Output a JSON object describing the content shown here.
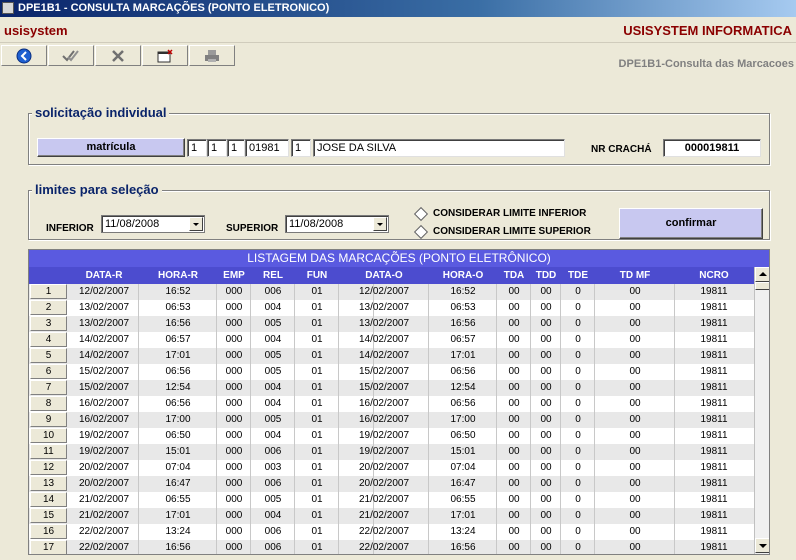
{
  "window": {
    "title": "DPE1B1 - CONSULTA MARCAÇÕES (PONTO ELETRONICO)"
  },
  "brand": {
    "left": "usisystem",
    "right": "USISYSTEM INFORMATICA"
  },
  "toolbar": {
    "buttons": [
      {
        "icon": "back-arrow-icon"
      },
      {
        "icon": "double-check-icon"
      },
      {
        "icon": "x-cancel-icon"
      },
      {
        "icon": "new-window-icon"
      },
      {
        "icon": "printer-icon"
      }
    ]
  },
  "subtitle": "DPE1B1-Consulta das Marcacoes",
  "individual": {
    "title": "solicitação individual",
    "matricula_button": "matrícula",
    "matricula_parts": [
      "1",
      "1",
      "1",
      "01981",
      "1"
    ],
    "name": "JOSE DA SILVA",
    "cracha_label": "NR CRACHÁ",
    "cracha_value": "000019811"
  },
  "limits": {
    "title": "limites para seleção",
    "inferior_label": "INFERIOR",
    "inferior_value": "11/08/2008",
    "superior_label": "SUPERIOR",
    "superior_value": "11/08/2008",
    "check_inferior": "CONSIDERAR LIMITE INFERIOR",
    "check_superior": "CONSIDERAR LIMITE SUPERIOR",
    "confirm_button": "confirmar"
  },
  "list": {
    "title": "LISTAGEM DAS MARCAÇÕES (PONTO ELETRÔNICO)",
    "columns": [
      "DATA-R",
      "HORA-R",
      "EMP",
      "REL",
      "FUN",
      "DATA-O",
      "HORA-O",
      "TDA",
      "TDD",
      "TDE",
      "TD MF",
      "NCRO"
    ],
    "rows": [
      [
        "1",
        "12/02/2007",
        "16:52",
        "000",
        "006",
        "01",
        "12/02/2007",
        "16:52",
        "00",
        "00",
        "0",
        "00",
        "19811"
      ],
      [
        "2",
        "13/02/2007",
        "06:53",
        "000",
        "004",
        "01",
        "13/02/2007",
        "06:53",
        "00",
        "00",
        "0",
        "00",
        "19811"
      ],
      [
        "3",
        "13/02/2007",
        "16:56",
        "000",
        "005",
        "01",
        "13/02/2007",
        "16:56",
        "00",
        "00",
        "0",
        "00",
        "19811"
      ],
      [
        "4",
        "14/02/2007",
        "06:57",
        "000",
        "004",
        "01",
        "14/02/2007",
        "06:57",
        "00",
        "00",
        "0",
        "00",
        "19811"
      ],
      [
        "5",
        "14/02/2007",
        "17:01",
        "000",
        "005",
        "01",
        "14/02/2007",
        "17:01",
        "00",
        "00",
        "0",
        "00",
        "19811"
      ],
      [
        "6",
        "15/02/2007",
        "06:56",
        "000",
        "005",
        "01",
        "15/02/2007",
        "06:56",
        "00",
        "00",
        "0",
        "00",
        "19811"
      ],
      [
        "7",
        "15/02/2007",
        "12:54",
        "000",
        "004",
        "01",
        "15/02/2007",
        "12:54",
        "00",
        "00",
        "0",
        "00",
        "19811"
      ],
      [
        "8",
        "16/02/2007",
        "06:56",
        "000",
        "004",
        "01",
        "16/02/2007",
        "06:56",
        "00",
        "00",
        "0",
        "00",
        "19811"
      ],
      [
        "9",
        "16/02/2007",
        "17:00",
        "000",
        "005",
        "01",
        "16/02/2007",
        "17:00",
        "00",
        "00",
        "0",
        "00",
        "19811"
      ],
      [
        "10",
        "19/02/2007",
        "06:50",
        "000",
        "004",
        "01",
        "19/02/2007",
        "06:50",
        "00",
        "00",
        "0",
        "00",
        "19811"
      ],
      [
        "11",
        "19/02/2007",
        "15:01",
        "000",
        "006",
        "01",
        "19/02/2007",
        "15:01",
        "00",
        "00",
        "0",
        "00",
        "19811"
      ],
      [
        "12",
        "20/02/2007",
        "07:04",
        "000",
        "003",
        "01",
        "20/02/2007",
        "07:04",
        "00",
        "00",
        "0",
        "00",
        "19811"
      ],
      [
        "13",
        "20/02/2007",
        "16:47",
        "000",
        "006",
        "01",
        "20/02/2007",
        "16:47",
        "00",
        "00",
        "0",
        "00",
        "19811"
      ],
      [
        "14",
        "21/02/2007",
        "06:55",
        "000",
        "005",
        "01",
        "21/02/2007",
        "06:55",
        "00",
        "00",
        "0",
        "00",
        "19811"
      ],
      [
        "15",
        "21/02/2007",
        "17:01",
        "000",
        "004",
        "01",
        "21/02/2007",
        "17:01",
        "00",
        "00",
        "0",
        "00",
        "19811"
      ],
      [
        "16",
        "22/02/2007",
        "13:24",
        "000",
        "006",
        "01",
        "22/02/2007",
        "13:24",
        "00",
        "00",
        "0",
        "00",
        "19811"
      ],
      [
        "17",
        "22/02/2007",
        "16:56",
        "000",
        "006",
        "01",
        "22/02/2007",
        "16:56",
        "00",
        "00",
        "0",
        "00",
        "19811"
      ]
    ]
  },
  "colors": {
    "title_bar": "#0A246A",
    "brand_text": "#8B0000",
    "group_title": "#0A246A",
    "button_lavender": "#C8C8F0",
    "list_header": "#4C4CCF",
    "row_alt": "#E8E8E8"
  }
}
